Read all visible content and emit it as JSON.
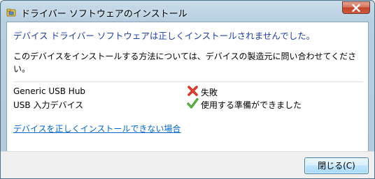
{
  "window": {
    "title": "ドライバー ソフトウェアのインストール",
    "title_icon": "device-folder-icon",
    "close_icon": "close-x-icon"
  },
  "content": {
    "headline": "デバイス ドライバー ソフトウェアは正しくインストールされませんでした。",
    "description": "このデバイスをインストールする方法については、デバイスの製造元に問い合わせてください。",
    "devices": [
      {
        "name": "Generic USB Hub",
        "status": "失敗",
        "status_icon": "red-x-icon"
      },
      {
        "name": "USB 入力デバイス",
        "status": "使用する準備ができました",
        "status_icon": "green-check-icon"
      }
    ],
    "help_link": "デバイスを正しくインストールできない場合"
  },
  "footer": {
    "close_button": "閉じる(C)"
  },
  "colors": {
    "headline": "#1e3fa0",
    "link": "#0066cc",
    "fail": "#d02a1e",
    "success": "#3f9a2e"
  }
}
